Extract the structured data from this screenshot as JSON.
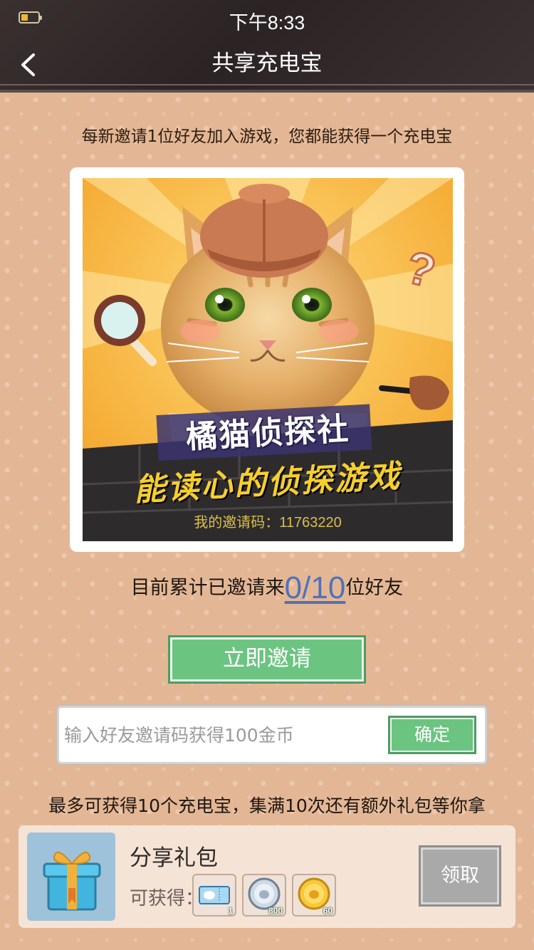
{
  "status_bar": {
    "time": "下午8:33",
    "battery_color": "#f0b92b"
  },
  "nav": {
    "back_icon": "chevron-left-icon",
    "title": "共享充电宝"
  },
  "intro_text": "每新邀请1位好友加入游戏，您都能获得一个充电宝",
  "poster": {
    "game_name": "橘猫侦探社",
    "slogan": "能读心的侦探游戏",
    "invite_code_text": "我的邀请码：11763220",
    "icons": [
      "magnifier-icon",
      "question-mark-icon",
      "pipe-icon",
      "detective-hat-icon"
    ]
  },
  "invite_progress": {
    "prefix": "目前累计已邀请来",
    "count": "0/10",
    "suffix": "位好友"
  },
  "invite_button": "立即邀请",
  "code_entry": {
    "placeholder": "输入好友邀请码获得100金币",
    "value": "",
    "confirm_label": "确定"
  },
  "bottom_note": "最多可获得10个充电宝，集满10次还有额外礼包等你拿",
  "gift_pack": {
    "title": "分享礼包",
    "rewards_label": "可获得：",
    "rewards": [
      {
        "icon": "ticket-icon",
        "qty": "1"
      },
      {
        "icon": "silver-coin-icon",
        "qty": "800"
      },
      {
        "icon": "gold-coin-icon",
        "qty": "60"
      }
    ],
    "claim_label": "领取"
  },
  "colors": {
    "header_bg": "#2b2324",
    "page_bg": "#e2b896",
    "accent_green": "#6cc481",
    "link_blue": "#4f72b8",
    "disabled_gray": "#a9a9a9"
  }
}
